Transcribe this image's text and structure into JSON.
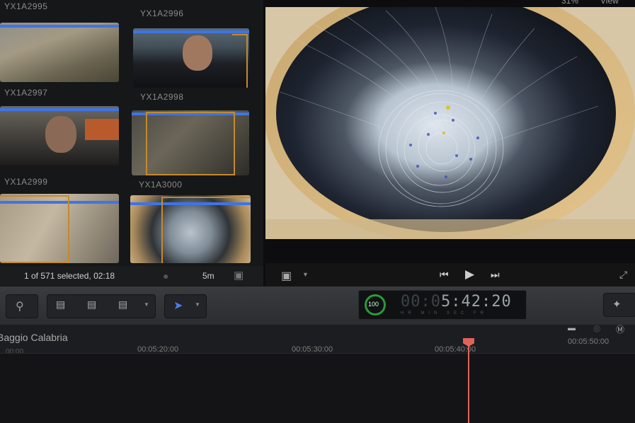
{
  "browser": {
    "top_clip_names": [
      "YX1A2995",
      "YX1A2996"
    ],
    "clips": [
      {
        "name": "YX1A2997"
      },
      {
        "name": "YX1A2998"
      },
      {
        "name": "YX1A2999"
      },
      {
        "name": "YX1A3000"
      }
    ],
    "selection_status": "1 of 571 selected, 02:18",
    "duration_label": "5m"
  },
  "viewer": {
    "zoom_label": "31%",
    "view_label": "View"
  },
  "toolbar": {
    "timecode_dim": "00:0",
    "timecode": "5:42:20",
    "timecode_units": "HR MIN SEC FR",
    "ring_value": "100"
  },
  "timeline": {
    "project_name": "Baggio Calabria",
    "project_time": "00:00",
    "ruler_labels": [
      "00:05:20:00",
      "00:05:30:00",
      "00:05:40:00",
      "00:05:50:00"
    ]
  },
  "colors": {
    "accent_blue": "#3e74e6",
    "selection_orange": "#c48a2c",
    "playhead": "#e0635a",
    "ring_green": "#2a9a3a"
  }
}
